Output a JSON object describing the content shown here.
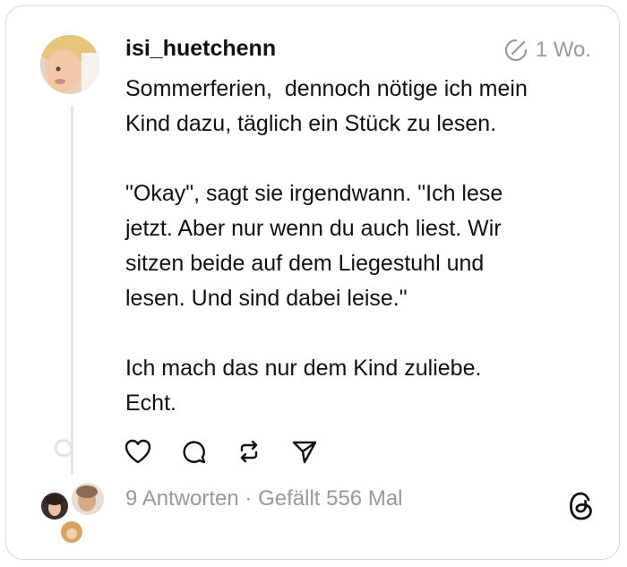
{
  "post": {
    "username": "isi_huetchenn",
    "time": "1 Wo.",
    "text": "Sommerferien,  dennoch nötige ich mein\nKind dazu, täglich ein Stück zu lesen.\n\n\"Okay\", sagt sie irgendwann. \"Ich lese\njetzt. Aber nur wenn du auch liest. Wir\nsitzen beide auf dem Liegestuhl und\nlesen. Und sind dabei leise.\"\n\nIch mach das nur dem Kind zuliebe.\nEcht.",
    "stats": "9 Antworten · Gefällt 556 Mal"
  },
  "icons": {
    "time": "circle-slash-icon",
    "like": "heart-icon",
    "reply": "comment-icon",
    "repost": "repost-icon",
    "share": "send-icon",
    "brand": "threads-logo-icon"
  },
  "colors": {
    "text": "#111111",
    "muted": "#999999",
    "border": "#d9d9d9",
    "thread_line": "#e4e4e4"
  }
}
